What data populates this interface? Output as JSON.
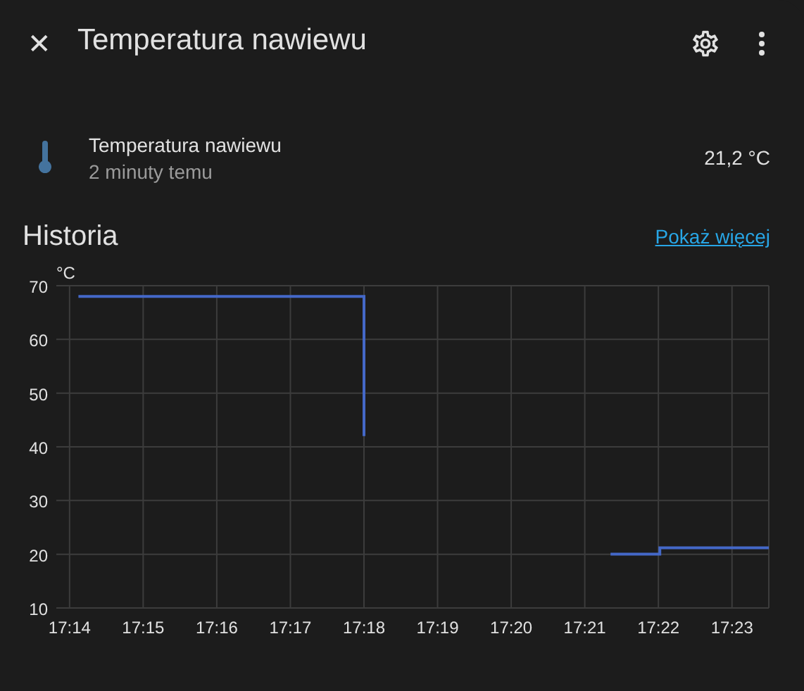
{
  "dialog": {
    "title": "Temperatura nawiewu",
    "close_icon": "✕"
  },
  "entity": {
    "name": "Temperatura nawiewu",
    "last_changed": "2 minuty temu",
    "state": "21,2 °C"
  },
  "history": {
    "title": "Historia",
    "more_link": "Pokaż więcej",
    "chart_data": {
      "type": "line",
      "ylabel": "°C",
      "grid": true,
      "x": [
        1034.12,
        1038.0,
        1038.0,
        1039.0,
        1041.35,
        1042.02,
        1042.02,
        1043.5
      ],
      "series": [
        {
          "color": "#4468c8",
          "values": [
            68,
            68,
            42,
            null,
            20,
            20,
            21.2,
            21.2
          ]
        }
      ],
      "xlim": [
        1033.82,
        1043.5
      ],
      "ylim": [
        10,
        70
      ],
      "yticks": [
        10,
        20,
        30,
        40,
        50,
        60,
        70
      ],
      "xticks": [
        {
          "value": 1034,
          "label": "17:14"
        },
        {
          "value": 1035,
          "label": "17:15"
        },
        {
          "value": 1036,
          "label": "17:16"
        },
        {
          "value": 1037,
          "label": "17:17"
        },
        {
          "value": 1038,
          "label": "17:18"
        },
        {
          "value": 1039,
          "label": "17:19"
        },
        {
          "value": 1040,
          "label": "17:20"
        },
        {
          "value": 1041,
          "label": "17:21"
        },
        {
          "value": 1042,
          "label": "17:22"
        },
        {
          "value": 1043,
          "label": "17:23"
        }
      ]
    }
  }
}
